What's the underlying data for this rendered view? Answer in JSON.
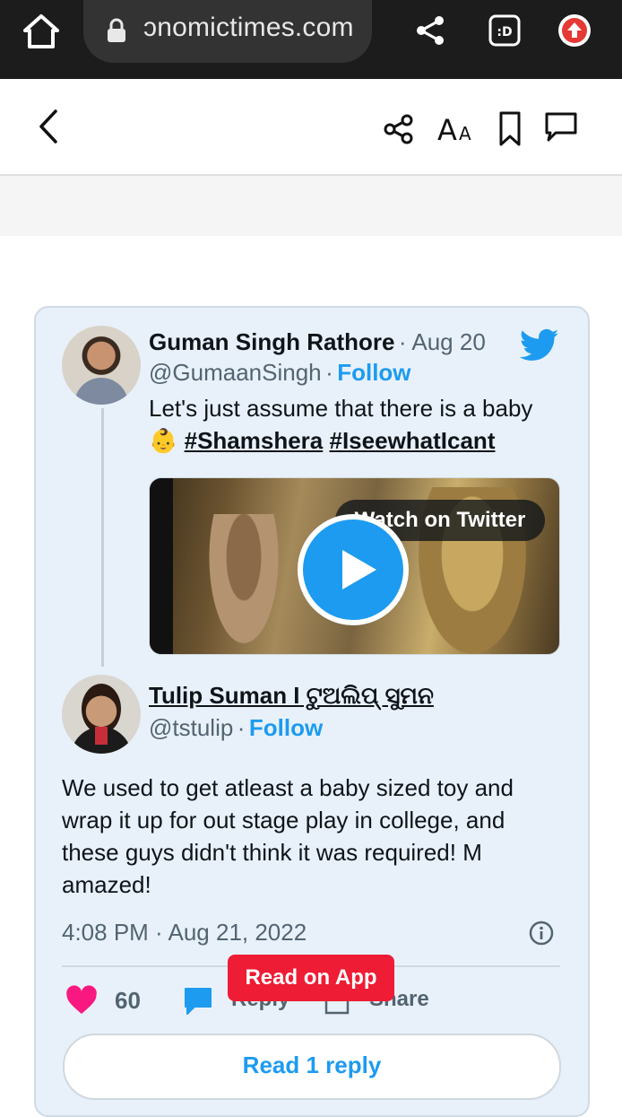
{
  "browser": {
    "url": "ɔnomictimes.com"
  },
  "tweet": {
    "author": {
      "name": "Guman Singh Rathore",
      "date": "· Aug 20",
      "handle": "@GumaanSingh",
      "separator": "·",
      "follow_label": "Follow"
    },
    "text_line1": "Let's just assume that there is a baby",
    "emoji": "👶",
    "hashtag1": "#Shamshera",
    "hashtag2": "#IseewhatIcant",
    "video": {
      "watch_label": "Watch on Twitter"
    }
  },
  "reply": {
    "author": {
      "name": "Tulip Suman I ଟୁଅଲିପ୍ ସୁମନ",
      "handle": "@tstulip",
      "separator": "·",
      "follow_label": "Follow"
    },
    "text": "We used to get atleast a baby sized toy and wrap it up for out stage play in college, and these guys didn't think it was required! M amazed!",
    "timestamp": "4:08 PM · Aug 21, 2022"
  },
  "actions": {
    "likes": "60",
    "reply_label": "Reply",
    "share_label": "Share",
    "read_replies_label": "Read 1 reply"
  },
  "banner": {
    "read_on_app_label": "Read on App"
  },
  "colors": {
    "twitter_blue": "#1d9bf0",
    "like_pink": "#f91880",
    "app_red": "#ee1c35",
    "card_bg": "#e8f1fa"
  }
}
